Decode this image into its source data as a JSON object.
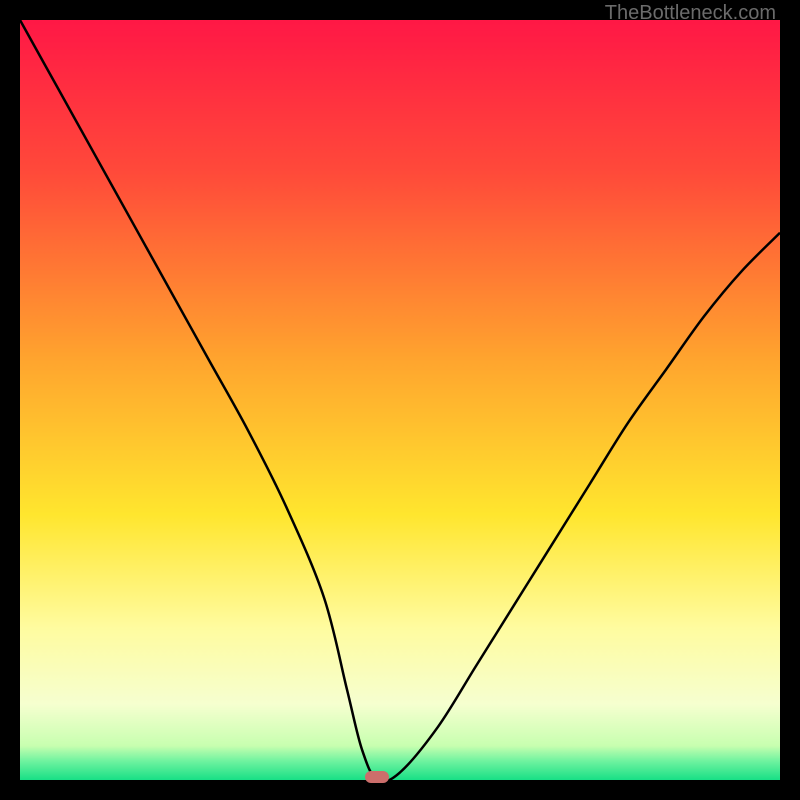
{
  "watermark": "TheBottleneck.com",
  "chart_data": {
    "type": "line",
    "title": "",
    "xlabel": "",
    "ylabel": "",
    "xlim": [
      0,
      100
    ],
    "ylim": [
      0,
      100
    ],
    "grid": false,
    "legend": false,
    "series": [
      {
        "name": "bottleneck-curve",
        "x": [
          0,
          5,
          10,
          15,
          20,
          25,
          30,
          35,
          40,
          43,
          45,
          47,
          50,
          55,
          60,
          65,
          70,
          75,
          80,
          85,
          90,
          95,
          100
        ],
        "values": [
          100,
          91,
          82,
          73,
          64,
          55,
          46,
          36,
          24,
          12,
          4,
          0,
          1,
          7,
          15,
          23,
          31,
          39,
          47,
          54,
          61,
          67,
          72
        ]
      }
    ],
    "marker": {
      "x": 47,
      "y": 0
    },
    "background_gradient": {
      "stops": [
        {
          "pos": 0.0,
          "color": "#ff1846"
        },
        {
          "pos": 0.2,
          "color": "#ff4a3a"
        },
        {
          "pos": 0.45,
          "color": "#ffa62e"
        },
        {
          "pos": 0.65,
          "color": "#ffe62e"
        },
        {
          "pos": 0.8,
          "color": "#fffca0"
        },
        {
          "pos": 0.9,
          "color": "#f6ffd0"
        },
        {
          "pos": 0.955,
          "color": "#c8ffb0"
        },
        {
          "pos": 0.975,
          "color": "#70f3a0"
        },
        {
          "pos": 1.0,
          "color": "#18e086"
        }
      ]
    }
  }
}
